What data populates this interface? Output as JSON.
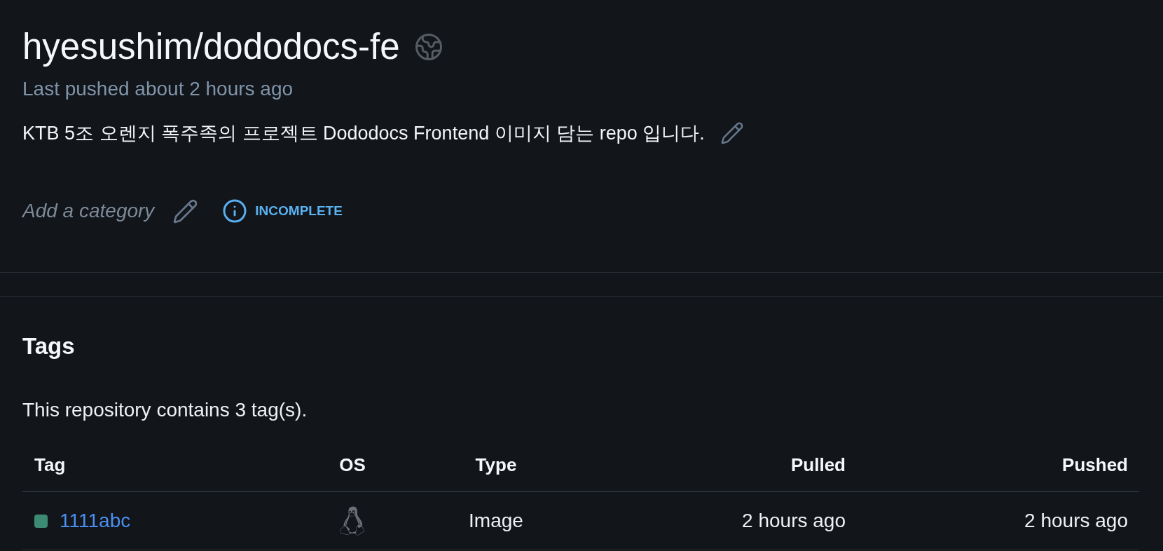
{
  "repository": {
    "name": "hyesushim/dododocs-fe",
    "last_pushed": "Last pushed about 2 hours ago",
    "description": "KTB 5조 오렌지 폭주족의 프로젝트 Dododocs Frontend 이미지 담는 repo 입니다."
  },
  "category": {
    "prompt": "Add a category",
    "status": "INCOMPLETE"
  },
  "tags": {
    "title": "Tags",
    "summary": "This repository contains 3 tag(s).",
    "table": {
      "columns": [
        "Tag",
        "OS",
        "Type",
        "Pulled",
        "Pushed"
      ],
      "rows": [
        {
          "tag": "1111abc",
          "color": "#3d8a73",
          "type": "Image",
          "pulled": "2 hours ago",
          "pushed": "2 hours ago"
        }
      ]
    }
  }
}
